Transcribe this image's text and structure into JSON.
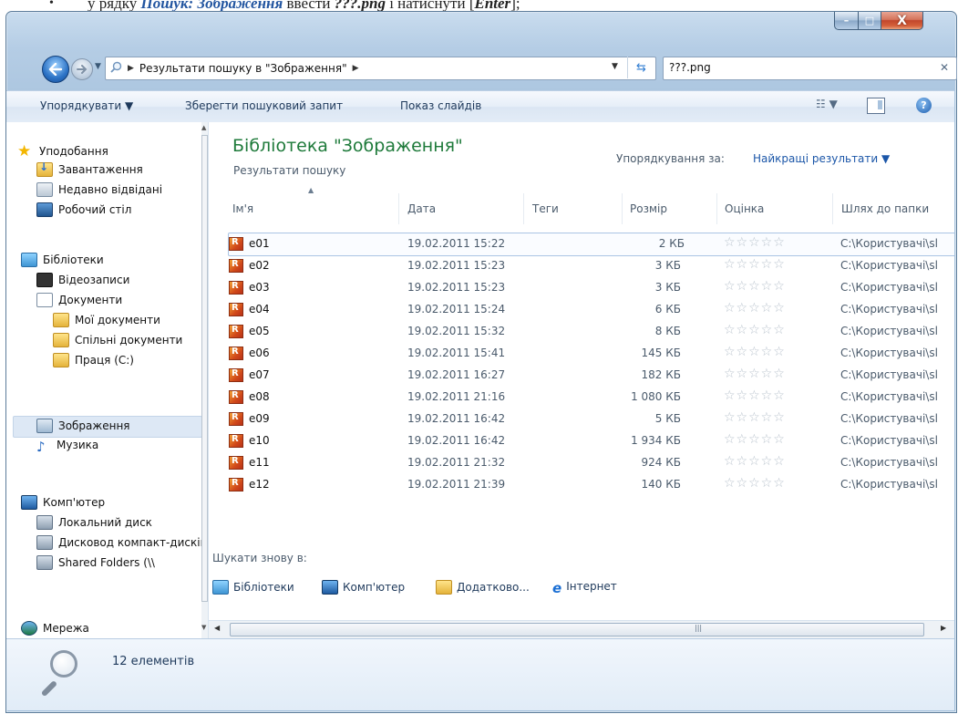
{
  "caption": {
    "prefix": "у рядку ",
    "field": "Пошук: Зображення",
    "middle": " ввести ",
    "query": "???.png",
    "suffix": " і натиснути [",
    "key": "Enter",
    "end": "];"
  },
  "window": {
    "btn_min": "–",
    "btn_max": "□",
    "btn_close": "X"
  },
  "address": {
    "breadcrumb": "Результати пошуку в \"Зображення\"",
    "search_value": "???.png"
  },
  "toolbar": {
    "organize": "Упорядкувати ▼",
    "save_search": "Зберегти пошуковий запит",
    "slideshow": "Показ слайдів",
    "help": "?"
  },
  "sidebar": {
    "favorites": "Уподобання",
    "downloads": "Завантаження",
    "recent": "Недавно відвідані",
    "desktop": "Робочий стіл",
    "libraries": "Бібліотеки",
    "videos": "Відеозаписи",
    "documents": "Документи",
    "my_documents": "Мої документи",
    "shared_documents": "Спільні документи",
    "work": "Праця (C:)",
    "pictures": "Зображення",
    "music": "Музика",
    "computer": "Комп'ютер",
    "local_disk": "Локальний диск",
    "dvd": "Дисковод компакт-дисків",
    "shared_folders": "Shared Folders (\\\\",
    "network": "Мережа"
  },
  "main": {
    "title": "Бібліотека \"Зображення\"",
    "subtitle": "Результати пошуку",
    "arrange_label": "Упорядкування за:",
    "arrange_value": "Найкращі результати ▼",
    "columns": {
      "name": "Ім'я",
      "date": "Дата",
      "tags": "Теги",
      "size": "Розмір",
      "rating": "Оцінка",
      "path": "Шлях до папки"
    },
    "files": [
      {
        "name": "e01",
        "date": "19.02.2011 15:22",
        "size": "2 КБ",
        "path": "C:\\Користувачі\\sl"
      },
      {
        "name": "e02",
        "date": "19.02.2011 15:23",
        "size": "3 КБ",
        "path": "C:\\Користувачі\\sl"
      },
      {
        "name": "e03",
        "date": "19.02.2011 15:23",
        "size": "3 КБ",
        "path": "C:\\Користувачі\\sl"
      },
      {
        "name": "e04",
        "date": "19.02.2011 15:24",
        "size": "6 КБ",
        "path": "C:\\Користувачі\\sl"
      },
      {
        "name": "e05",
        "date": "19.02.2011 15:32",
        "size": "8 КБ",
        "path": "C:\\Користувачі\\sl"
      },
      {
        "name": "e06",
        "date": "19.02.2011 15:41",
        "size": "145 КБ",
        "path": "C:\\Користувачі\\sl"
      },
      {
        "name": "e07",
        "date": "19.02.2011 16:27",
        "size": "182 КБ",
        "path": "C:\\Користувачі\\sl"
      },
      {
        "name": "e08",
        "date": "19.02.2011 21:16",
        "size": "1 080 КБ",
        "path": "C:\\Користувачі\\sl"
      },
      {
        "name": "e09",
        "date": "19.02.2011 16:42",
        "size": "5 КБ",
        "path": "C:\\Користувачі\\sl"
      },
      {
        "name": "e10",
        "date": "19.02.2011 16:42",
        "size": "1 934 КБ",
        "path": "C:\\Користувачі\\sl"
      },
      {
        "name": "e11",
        "date": "19.02.2011 21:32",
        "size": "924 КБ",
        "path": "C:\\Користувачі\\sl"
      },
      {
        "name": "e12",
        "date": "19.02.2011 21:39",
        "size": "140 КБ",
        "path": "C:\\Користувачі\\sl"
      }
    ],
    "rating_stars": "☆☆☆☆☆",
    "search_again_label": "Шукати знову в:",
    "search_again": {
      "libraries": "Бібліотеки",
      "computer": "Комп'ютер",
      "more": "Додатково...",
      "internet": "Інтернет"
    }
  },
  "details": {
    "item_count": "12 елементів"
  }
}
